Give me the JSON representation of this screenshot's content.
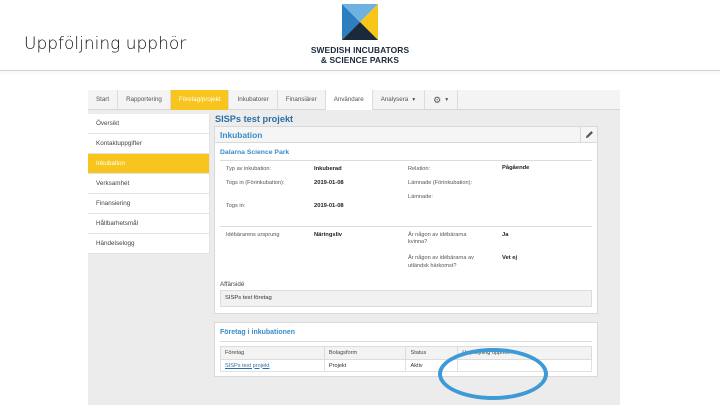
{
  "slide": {
    "title": "Uppföljning upphör"
  },
  "logo": {
    "line1": "SWEDISH INCUBATORS",
    "line2": "& SCIENCE PARKS",
    "color_blue": "#2b7fc0",
    "color_yellow": "#f8c616",
    "color_navy": "#1b2a3a"
  },
  "nav": {
    "tabs": [
      {
        "label": "Start"
      },
      {
        "label": "Rapportering"
      },
      {
        "label": "Företag/projekt"
      },
      {
        "label": "Inkubatorer"
      },
      {
        "label": "Finansiärer"
      },
      {
        "label": "Användare"
      },
      {
        "label": "Analysera"
      }
    ],
    "gear_icon": "gear-icon",
    "accent": "#f7c51e"
  },
  "sidebar": {
    "items": [
      {
        "label": "Översikt"
      },
      {
        "label": "Kontaktuppgifter"
      },
      {
        "label": "Inkubation"
      },
      {
        "label": "Verksamhet"
      },
      {
        "label": "Finansiering"
      },
      {
        "label": "Hållbarhetsmål"
      },
      {
        "label": "Händelselogg"
      }
    ],
    "active_index": 2
  },
  "main": {
    "project_title": "SISPs test projekt",
    "section_title": "Inkubation",
    "park_name": "Dalarna Science Park",
    "fields": {
      "typ_label": "Typ av inkubation:",
      "typ_value": "Inkuberad",
      "togs_fi_label": "Togs in (Förinkubation):",
      "togs_fi_value": "2019-01-08",
      "togs_label": "Togs in:",
      "togs_value": "2019-01-08",
      "relation_label": "Relation:",
      "relation_value": "Pågående",
      "lamnade_fi_label": "Lämnade (Förinkubation):",
      "lamnade_label": "Lämnade:",
      "ursprung_label": "Idébärarens ursprung",
      "ursprung_value": "Näringsliv",
      "kvinna_label1": "Är någon av idébärarna",
      "kvinna_label2": "kvinna?",
      "kvinna_value": "Ja",
      "utlandsk_label1": "Är någon av idébärarna av",
      "utlandsk_label2": "utländsk härkomst?",
      "utlandsk_value": "Vet ej"
    },
    "affarside_label": "Affärsidé",
    "affarside_value": "SISPs test företag",
    "section2_title": "Företag i inkubationen",
    "table": {
      "headers": [
        "Företag",
        "Bolagsform",
        "Status",
        "Uppföljning upphör"
      ],
      "rows": [
        [
          "SISPs test projekt",
          "Projekt",
          "Aktiv",
          ""
        ]
      ]
    }
  },
  "highlight_color": "#3d9ad6"
}
